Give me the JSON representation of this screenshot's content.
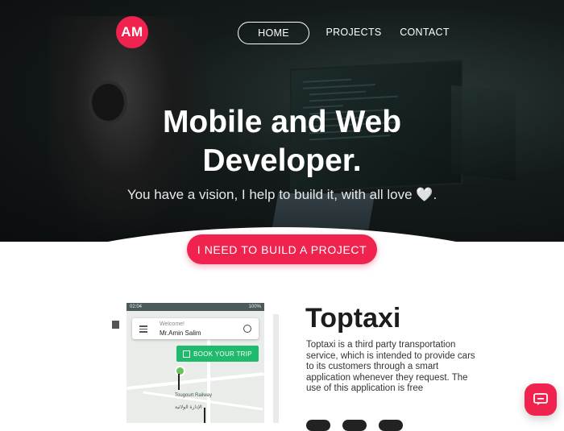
{
  "brand": {
    "logo_text": "AM",
    "accent_color": "#f0234e"
  },
  "nav": {
    "items": [
      {
        "label": "HOME",
        "active": true
      },
      {
        "label": "PROJECTS",
        "active": false
      },
      {
        "label": "CONTACT",
        "active": false
      }
    ]
  },
  "hero": {
    "headline_line1": "Mobile and Web",
    "headline_line2": "Developer.",
    "subtitle": "You have a vision, I help to build it, with all love 🤍.",
    "cta_label": "I NEED TO BUILD A PROJECT"
  },
  "project": {
    "title": "Toptaxi",
    "description": "Toptaxi is a third party transportation service, which is intended to provide cars to its customers through a smart application whenever they request. The use of this application is free",
    "phone": {
      "status_left": "02:04",
      "status_right": "100%",
      "welcome_label": "Welcome!",
      "user_name": "Mr.Amin Salim",
      "book_button_label": "BOOK YOUR TRIP",
      "map_label_1": "Tougourt Railway",
      "map_label_2": "الإدارة الولائية",
      "book_button_color": "#1fba6b"
    }
  },
  "chat": {
    "icon": "chat-bubble-icon"
  }
}
